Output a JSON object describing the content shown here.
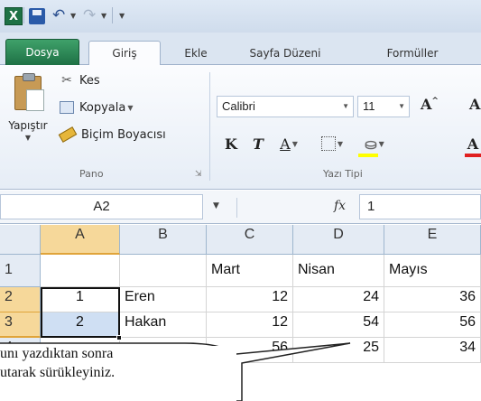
{
  "quick_access": {
    "app_icon": "excel-icon",
    "save_icon": "save-icon",
    "undo_icon": "undo-icon",
    "redo_icon": "redo-icon",
    "customize_icon": "customize-qat-icon"
  },
  "tabs": {
    "file": "Dosya",
    "home": "Giriş",
    "insert": "Ekle",
    "page_layout": "Sayfa Düzeni",
    "formulas": "Formüller"
  },
  "ribbon": {
    "clipboard": {
      "paste": "Yapıştır",
      "cut": "Kes",
      "copy": "Kopyala",
      "format_painter": "Biçim Boyacısı",
      "group_label": "Pano"
    },
    "font": {
      "font_name": "Calibri",
      "font_size": "11",
      "bold": "K",
      "italic": "T",
      "underline": "A",
      "grow": "A",
      "font_color_glyph": "A",
      "group_label": "Yazı Tipi"
    },
    "colors": {
      "fill": "#ffff00",
      "font_color": "#e02020",
      "file_tab": "#1e7145"
    }
  },
  "formula_bar": {
    "name_box": "A2",
    "fx": "fx",
    "value": "1"
  },
  "grid": {
    "columns": [
      "A",
      "B",
      "C",
      "D",
      "E"
    ],
    "rows": [
      {
        "row": "1",
        "A": "",
        "B": "",
        "C": "Mart",
        "D": "Nisan",
        "E": "Mayıs"
      },
      {
        "row": "2",
        "A": "1",
        "B": "Eren",
        "C": "12",
        "D": "24",
        "E": "36"
      },
      {
        "row": "3",
        "A": "2",
        "B": "Hakan",
        "C": "12",
        "D": "54",
        "E": "56"
      },
      {
        "row": "4",
        "A": "",
        "B": "",
        "C": "56",
        "D": "25",
        "E": "34"
      }
    ]
  },
  "callout": {
    "line1": "unı yazdıktan sonra",
    "line2": "utarak sürükleyiniz."
  }
}
